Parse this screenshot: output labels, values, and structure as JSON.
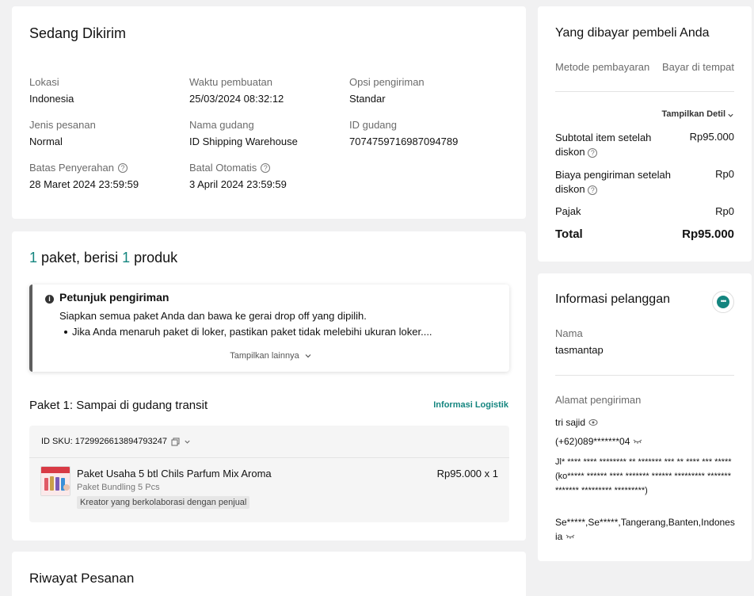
{
  "status": {
    "title": "Sedang Dikirim",
    "fields": [
      {
        "label": "Lokasi",
        "value": "Indonesia"
      },
      {
        "label": "Waktu pembuatan",
        "value": "25/03/2024 08:32:12"
      },
      {
        "label": "Opsi pengiriman",
        "value": "Standar"
      },
      {
        "label": "Jenis pesanan",
        "value": "Normal"
      },
      {
        "label": "Nama gudang",
        "value": "ID Shipping Warehouse"
      },
      {
        "label": "ID gudang",
        "value": "7074759716987094789"
      },
      {
        "label": "Batas Penyerahan",
        "value": "28 Maret 2024 23:59:59"
      },
      {
        "label": "Batal Otomatis",
        "value": "3 April 2024 23:59:59"
      }
    ]
  },
  "package": {
    "count": "1",
    "text_mid": " paket, berisi ",
    "product_count": "1",
    "text_end": " produk",
    "guide": {
      "title": "Petunjuk pengiriman",
      "text": "Siapkan semua paket Anda dan bawa ke gerai drop off yang dipilih.",
      "bullet": "Jika Anda menaruh paket di loker, pastikan paket tidak melebihi ukuran loker....",
      "more": "Tampilkan lainnya"
    },
    "status": "Paket 1: Sampai di gudang transit",
    "logistics_link": "Informasi Logistik",
    "sku_id": "ID SKU: 1729926613894793247",
    "product": {
      "name": "Paket Usaha 5 btl Chils Parfum Mix Aroma",
      "variant": "Paket Bundling 5 Pcs",
      "tag": "Kreator yang berkolaborasi dengan penjual",
      "price": "Rp95.000 x 1"
    }
  },
  "history": {
    "title": "Riwayat Pesanan"
  },
  "payment": {
    "title": "Yang dibayar pembeli Anda",
    "method_label": "Metode pembayaran",
    "method_value": "Bayar di tempat",
    "show_detail": "Tampilkan Detil",
    "subtotal_label_1": "Subtotal item setelah",
    "subtotal_label_2": "diskon",
    "subtotal_value": "Rp95.000",
    "shipping_label_1": "Biaya pengiriman setelah",
    "shipping_label_2": "diskon",
    "shipping_value": "Rp0",
    "tax_label": "Pajak",
    "tax_value": "Rp0",
    "total_label": "Total",
    "total_value": "Rp95.000"
  },
  "customer": {
    "title": "Informasi pelanggan",
    "name_label": "Nama",
    "name_value": "tasmantap",
    "address_label": "Alamat pengiriman",
    "recipient": "tri sajid",
    "phone": "(+62)089*******04",
    "address_line": "Jl* **** **** ******** ** ******* *** ** **** *** *****(ko***** ****** **** ******* ****** ********* ******* ******* ********* *********)",
    "region": "Se*****,Se*****,Tangerang,Banten,Indonesia"
  },
  "colors": {
    "accent": "#14857f",
    "background": "#f1f1f2"
  }
}
